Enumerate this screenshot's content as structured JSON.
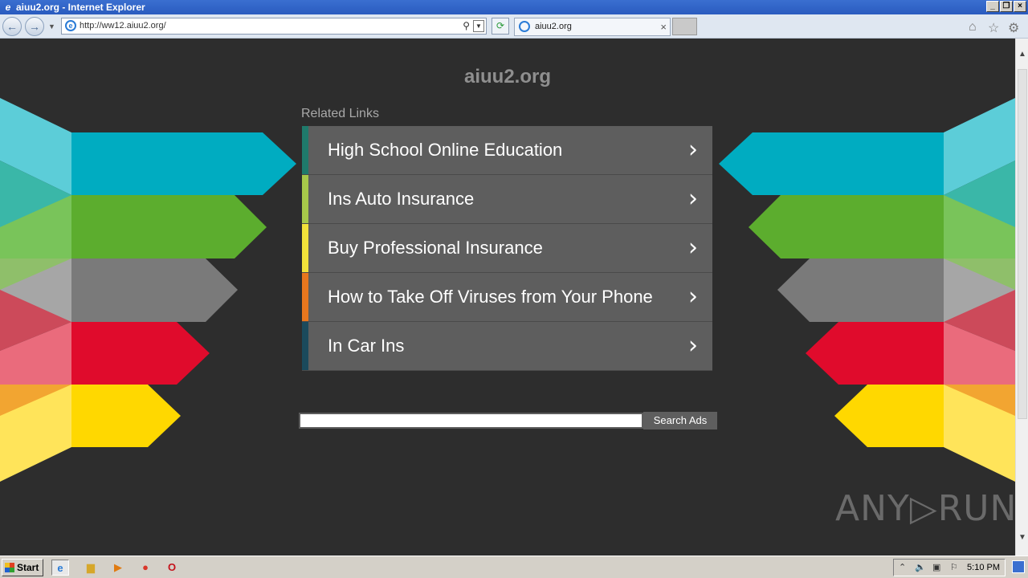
{
  "window": {
    "title": "aiuu2.org - Internet Explorer"
  },
  "navbar": {
    "address": "http://ww12.aiuu2.org/",
    "tab_title": "aiuu2.org"
  },
  "page": {
    "domain": "aiuu2.org",
    "related_label": "Related Links",
    "links": [
      {
        "text": "High School Online Education",
        "color": "#1f7a6b"
      },
      {
        "text": "Ins Auto Insurance",
        "color": "#a6c84a"
      },
      {
        "text": "Buy Professional Insurance",
        "color": "#f2e23a"
      },
      {
        "text": "How to Take Off Viruses from Your Phone",
        "color": "#e8771e"
      },
      {
        "text": "In Car Ins",
        "color": "#1b4a5c"
      }
    ],
    "search_button": "Search Ads",
    "watermark": "ANY▷RUN"
  },
  "taskbar": {
    "start": "Start",
    "clock": "5:10 PM"
  },
  "colors": {
    "background": "#2d2d2d",
    "arrow_teal": "#00acc1",
    "arrow_green": "#5cad2e",
    "arrow_gray": "#7a7a7a",
    "arrow_red": "#e00b2c",
    "arrow_yellow": "#ffd800"
  }
}
